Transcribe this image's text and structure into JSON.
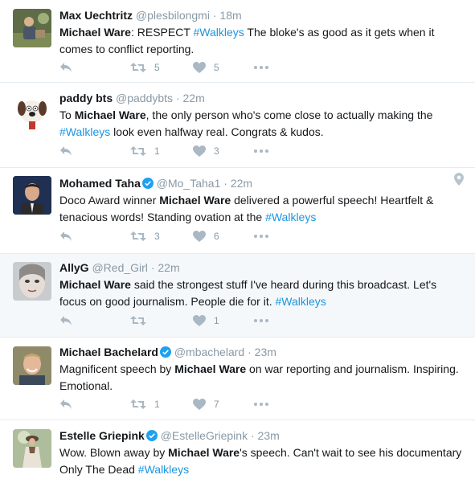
{
  "colors": {
    "link": "#1b95e0",
    "muted": "#8899a6",
    "border": "#e6ecf0",
    "highlight": "#f5f8fa"
  },
  "tweets": [
    {
      "name": "Max Uechtritz",
      "handle": "@plesbilongmi",
      "time": "18m",
      "verified": false,
      "parts": [
        {
          "b": "Michael Ware"
        },
        {
          "t": ": RESPECT "
        },
        {
          "h": "#Walkleys"
        },
        {
          "t": "  The bloke's as good as it gets when it comes to conflict reporting."
        }
      ],
      "retweets": "5",
      "likes": "5"
    },
    {
      "name": "paddy bts",
      "handle": "@paddybts",
      "time": "22m",
      "verified": false,
      "parts": [
        {
          "t": "To "
        },
        {
          "b": "Michael Ware"
        },
        {
          "t": ", the only person who's come close to actually making the "
        },
        {
          "h": "#Walkleys"
        },
        {
          "t": " look even halfway real. Congrats & kudos."
        }
      ],
      "retweets": "1",
      "likes": "3"
    },
    {
      "name": "Mohamed Taha",
      "handle": "@Mo_Taha1",
      "time": "22m",
      "verified": true,
      "parts": [
        {
          "t": "Doco Award winner "
        },
        {
          "b": "Michael Ware"
        },
        {
          "t": " delivered a powerful speech! Heartfelt & tenacious words! Standing ovation at the "
        },
        {
          "h": "#Walkleys"
        }
      ],
      "retweets": "3",
      "likes": "6"
    },
    {
      "name": "AllyG",
      "handle": "@Red_Girl",
      "time": "22m",
      "verified": false,
      "parts": [
        {
          "b": "Michael Ware"
        },
        {
          "t": " said the strongest stuff I've heard during this broadcast. Let's focus on good journalism. People die for it. "
        },
        {
          "h": "#Walkleys"
        }
      ],
      "retweets": "",
      "likes": "1"
    },
    {
      "name": "Michael Bachelard",
      "handle": "@mbachelard",
      "time": "23m",
      "verified": true,
      "parts": [
        {
          "t": "Magnificent speech by "
        },
        {
          "b": "Michael Ware"
        },
        {
          "t": " on war reporting and journalism. Inspiring. Emotional."
        }
      ],
      "retweets": "1",
      "likes": "7"
    },
    {
      "name": "Estelle Griepink",
      "handle": "@EstelleGriepink",
      "time": "23m",
      "verified": true,
      "parts": [
        {
          "t": "Wow. Blown away by "
        },
        {
          "b": "Michael Ware"
        },
        {
          "t": "'s speech. Can't wait to see his documentary Only The Dead "
        },
        {
          "h": "#Walkleys"
        }
      ],
      "retweets": "",
      "likes": ""
    }
  ]
}
